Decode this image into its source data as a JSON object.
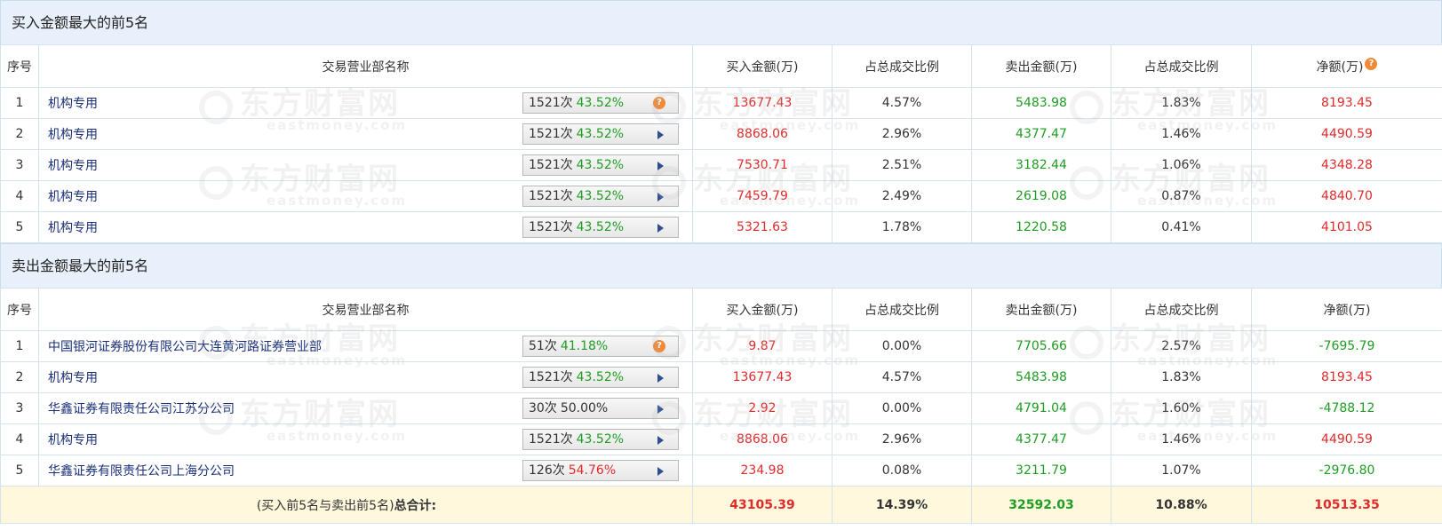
{
  "buy": {
    "title": "买入金额最大的前5名",
    "headers": [
      "序号",
      "交易营业部名称",
      "买入金额(万)",
      "占总成交比例",
      "卖出金额(万)",
      "占总成交比例",
      "净额(万)"
    ],
    "rows": [
      {
        "idx": "1",
        "name": "机构专用",
        "times": "1521次",
        "pct": "43.52%",
        "pct_color": "green",
        "action": "help",
        "buy": "13677.43",
        "buy_ratio": "4.57%",
        "sell": "5483.98",
        "sell_ratio": "1.83%",
        "net": "8193.45",
        "net_color": "red"
      },
      {
        "idx": "2",
        "name": "机构专用",
        "times": "1521次",
        "pct": "43.52%",
        "pct_color": "green",
        "action": "play",
        "buy": "8868.06",
        "buy_ratio": "2.96%",
        "sell": "4377.47",
        "sell_ratio": "1.46%",
        "net": "4490.59",
        "net_color": "red"
      },
      {
        "idx": "3",
        "name": "机构专用",
        "times": "1521次",
        "pct": "43.52%",
        "pct_color": "green",
        "action": "play",
        "buy": "7530.71",
        "buy_ratio": "2.51%",
        "sell": "3182.44",
        "sell_ratio": "1.06%",
        "net": "4348.28",
        "net_color": "red"
      },
      {
        "idx": "4",
        "name": "机构专用",
        "times": "1521次",
        "pct": "43.52%",
        "pct_color": "green",
        "action": "play",
        "buy": "7459.79",
        "buy_ratio": "2.49%",
        "sell": "2619.08",
        "sell_ratio": "0.87%",
        "net": "4840.70",
        "net_color": "red"
      },
      {
        "idx": "5",
        "name": "机构专用",
        "times": "1521次",
        "pct": "43.52%",
        "pct_color": "green",
        "action": "play",
        "buy": "5321.63",
        "buy_ratio": "1.78%",
        "sell": "1220.58",
        "sell_ratio": "0.41%",
        "net": "4101.05",
        "net_color": "red"
      }
    ]
  },
  "sell": {
    "title": "卖出金额最大的前5名",
    "headers": [
      "序号",
      "交易营业部名称",
      "买入金额(万)",
      "占总成交比例",
      "卖出金额(万)",
      "占总成交比例",
      "净额(万)"
    ],
    "rows": [
      {
        "idx": "1",
        "name": "中国银河证券股份有限公司大连黄河路证券营业部",
        "times": "51次",
        "pct": "41.18%",
        "pct_color": "green",
        "action": "help",
        "buy": "9.87",
        "buy_ratio": "0.00%",
        "sell": "7705.66",
        "sell_ratio": "2.57%",
        "net": "-7695.79",
        "net_color": "green"
      },
      {
        "idx": "2",
        "name": "机构专用",
        "times": "1521次",
        "pct": "43.52%",
        "pct_color": "green",
        "action": "play",
        "buy": "13677.43",
        "buy_ratio": "4.57%",
        "sell": "5483.98",
        "sell_ratio": "1.83%",
        "net": "8193.45",
        "net_color": "red"
      },
      {
        "idx": "3",
        "name": "华鑫证券有限责任公司江苏分公司",
        "times": "30次",
        "pct": "50.00%",
        "pct_color": "black",
        "action": "play",
        "buy": "2.92",
        "buy_ratio": "0.00%",
        "sell": "4791.04",
        "sell_ratio": "1.60%",
        "net": "-4788.12",
        "net_color": "green"
      },
      {
        "idx": "4",
        "name": "机构专用",
        "times": "1521次",
        "pct": "43.52%",
        "pct_color": "green",
        "action": "play",
        "buy": "8868.06",
        "buy_ratio": "2.96%",
        "sell": "4377.47",
        "sell_ratio": "1.46%",
        "net": "4490.59",
        "net_color": "red"
      },
      {
        "idx": "5",
        "name": "华鑫证券有限责任公司上海分公司",
        "times": "126次",
        "pct": "54.76%",
        "pct_color": "red",
        "action": "play",
        "buy": "234.98",
        "buy_ratio": "0.08%",
        "sell": "3211.79",
        "sell_ratio": "1.07%",
        "net": "-2976.80",
        "net_color": "green"
      }
    ],
    "total": {
      "label_prefix": "(买入前5名与卖出前5名)",
      "label_bold": "总合计:",
      "buy": "43105.39",
      "buy_ratio": "14.39%",
      "sell": "32592.03",
      "sell_ratio": "10.88%",
      "net": "10513.35"
    }
  },
  "watermark": {
    "cn": "东方财富网",
    "en": "eastmoney.com"
  },
  "colors": {
    "red": "#e12b2b",
    "green": "#1f9d23",
    "title_bg": "#e8f1fb",
    "total_bg": "#fff8dc",
    "border": "#d5e2ef"
  }
}
